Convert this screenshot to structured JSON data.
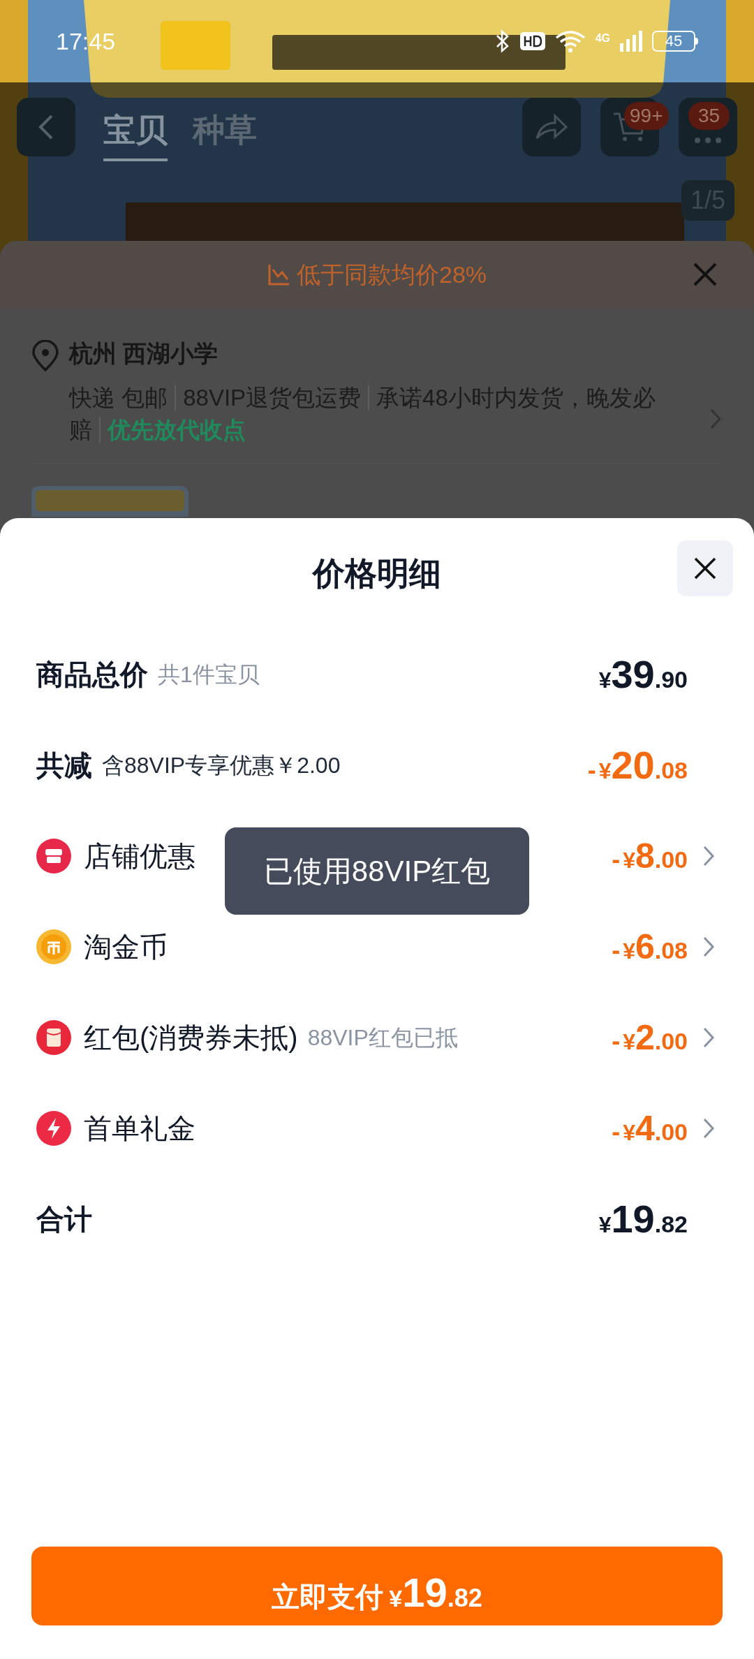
{
  "status_bar": {
    "time": "17:45",
    "network": "4G",
    "battery": "45"
  },
  "nav": {
    "tabs": [
      {
        "label": "宝贝",
        "selected": true
      },
      {
        "label": "种草",
        "selected": false
      }
    ],
    "cart_badge": "99+",
    "message_badge": "35",
    "image_counter": "1/5"
  },
  "shipping_sheet": {
    "price_hint": "低于同款均价28%",
    "location": "杭州 西湖小学",
    "services": [
      "快递 包邮",
      "88VIP退货包运费",
      "承诺48小时内发货，晚发必赔"
    ],
    "highlight": "优先放代收点"
  },
  "price_detail": {
    "title": "价格明细",
    "rows": [
      {
        "kind": "summary",
        "label": "商品总价",
        "note": "共1件宝贝",
        "amount": {
          "currency": "¥",
          "whole": "39",
          "fraction": ".90"
        }
      },
      {
        "kind": "discount",
        "label": "共减",
        "note": "含88VIP专享优惠￥2.00",
        "amount": {
          "sign": "-",
          "currency": "¥",
          "whole": "20",
          "fraction": ".08"
        }
      },
      {
        "kind": "item",
        "label": "店铺优惠",
        "amount": {
          "sign": "-",
          "currency": "¥",
          "whole": "8",
          "fraction": ".00"
        }
      },
      {
        "kind": "item",
        "label": "淘金币",
        "amount": {
          "sign": "-",
          "currency": "¥",
          "whole": "6",
          "fraction": ".08"
        }
      },
      {
        "kind": "item",
        "label": "红包(消费券未抵)",
        "note": "88VIP红包已抵",
        "amount": {
          "sign": "-",
          "currency": "¥",
          "whole": "2",
          "fraction": ".00"
        }
      },
      {
        "kind": "item",
        "label": "首单礼金",
        "amount": {
          "sign": "-",
          "currency": "¥",
          "whole": "4",
          "fraction": ".00"
        }
      },
      {
        "kind": "summary",
        "label": "合计",
        "amount": {
          "currency": "¥",
          "whole": "19",
          "fraction": ".82"
        }
      }
    ],
    "pay_button": {
      "label": "立即支付",
      "currency": "¥",
      "whole": "19",
      "fraction": ".82"
    }
  },
  "toast": "已使用88VIP红包"
}
